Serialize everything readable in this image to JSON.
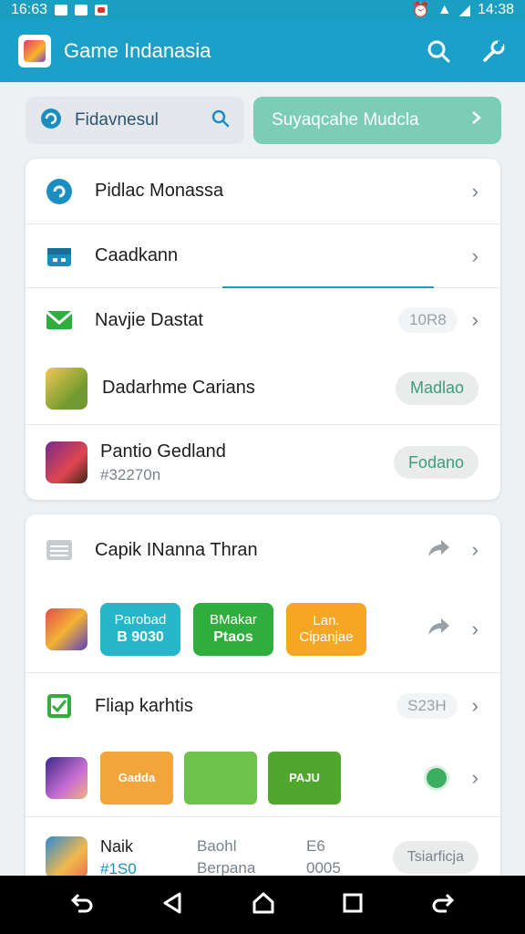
{
  "status_bar": {
    "time_left": "16:63",
    "time_right": "14:38"
  },
  "app_bar": {
    "title": "Game Indanasia",
    "search_icon": "search-icon",
    "settings_icon": "wrench-icon"
  },
  "search": {
    "label": "Fidavnesul"
  },
  "cta": {
    "label": "Suyaqcahe Mudcla"
  },
  "card1": {
    "row1": {
      "title": "Pidlac Monassa"
    },
    "row2": {
      "title": "Caadkann"
    },
    "row3": {
      "title": "Navjie Dastat",
      "meta": "10R8"
    },
    "row4": {
      "title": "Dadarhme Carians",
      "button": "Madlao"
    },
    "row5": {
      "title": "Pantio Gedland",
      "subtitle": "#32270n",
      "button": "Fodano"
    }
  },
  "card2": {
    "row1": {
      "title": "Capik INanna Thran"
    },
    "tiles": [
      {
        "line1": "Parobad",
        "line2": "B 9030",
        "color": "#27b6c9"
      },
      {
        "line1": "BMakar",
        "line2": "Ptaos",
        "color": "#2fae3d"
      },
      {
        "line1": "Lan.",
        "line2": "Cipanjae",
        "color": "#f5a623"
      }
    ],
    "row3": {
      "title": "Fliap karhtis",
      "meta": "S23H"
    },
    "game_tiles": [
      {
        "label": "Gadda",
        "color": "#f3a53b"
      },
      {
        "label": "",
        "color": "#6cc24a"
      },
      {
        "label": "PAJU",
        "color": "#4fa82d"
      }
    ],
    "row5": {
      "title": "Naik",
      "subtitle": "#1S0",
      "col2_top": "Baohl",
      "col2_bottom": "Berpana",
      "col3_top": "E6",
      "col3_bottom": "0005",
      "button": "Tsiarficja"
    }
  }
}
